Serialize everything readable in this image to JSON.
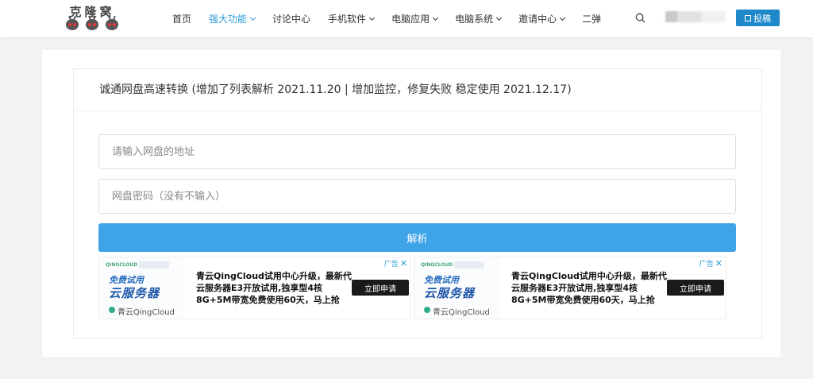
{
  "header": {
    "logo_text": "克隆窝",
    "nav": [
      {
        "label": "首页",
        "dropdown": false,
        "active": false
      },
      {
        "label": "强大功能",
        "dropdown": true,
        "active": true
      },
      {
        "label": "讨论中心",
        "dropdown": false,
        "active": false
      },
      {
        "label": "手机软件",
        "dropdown": true,
        "active": false
      },
      {
        "label": "电脑应用",
        "dropdown": true,
        "active": false
      },
      {
        "label": "电脑系统",
        "dropdown": true,
        "active": false
      },
      {
        "label": "邀请中心",
        "dropdown": true,
        "active": false
      },
      {
        "label": "二弹",
        "dropdown": false,
        "active": false
      }
    ],
    "post_label": "投稿",
    "search_icon": "search-icon",
    "accent_color": "#2d9bd8",
    "post_color": "#1e88c9"
  },
  "card": {
    "title": "诚通网盘高速转换 (增加了列表解析 2021.11.20 | 增加监控，修复失败 稳定使用 2021.12.17)"
  },
  "form": {
    "url_placeholder": "请输入网盘的地址",
    "url_value": "",
    "password_placeholder": "网盘密码（没有不输入）",
    "password_value": "",
    "parse_label": "解析",
    "parse_color": "#3fa3e8"
  },
  "ads": [
    {
      "brand_top": "QINGCLOUD",
      "free_label": "免费试用",
      "server_label": "云服务器",
      "logo_text": "青云QingCloud",
      "text": "青云QingCloud试用中心升级，最新代云服务器E3开放试用,独享型4核8G+5M带宽免费使用60天，马上抢",
      "cta": "立即申请",
      "ad_label": "广告",
      "close": "✕"
    },
    {
      "brand_top": "QINGCLOUD",
      "free_label": "免费试用",
      "server_label": "云服务器",
      "logo_text": "青云QingCloud",
      "text": "青云QingCloud试用中心升级，最新代云服务器E3开放试用,独享型4核8G+5M带宽免费使用60天，马上抢",
      "cta": "立即申请",
      "ad_label": "广告",
      "close": "✕"
    }
  ]
}
